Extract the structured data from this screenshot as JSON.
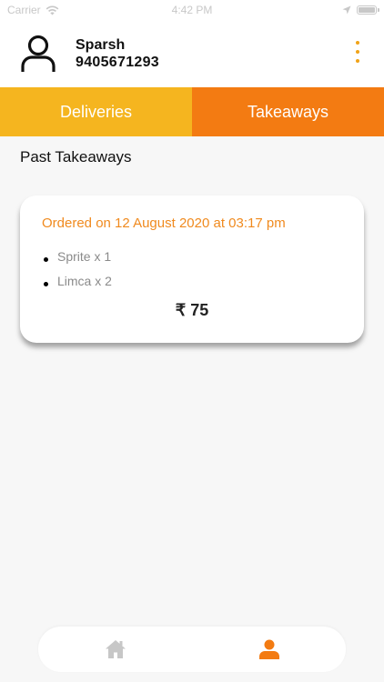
{
  "status_bar": {
    "carrier": "Carrier",
    "time": "4:42 PM"
  },
  "profile": {
    "name": "Sparsh",
    "phone": "9405671293",
    "avatar_icon": "user-outline-icon",
    "menu_icon": "more-vertical-icon"
  },
  "tabs": [
    {
      "label": "Deliveries",
      "color": "#f5b51f"
    },
    {
      "label": "Takeaways",
      "color": "#f37b12"
    }
  ],
  "section_title": "Past Takeaways",
  "orders": [
    {
      "date_text": "Ordered on 12 August 2020  at 03:17 pm",
      "items": [
        "Sprite x 1",
        "Limca x 2"
      ],
      "total": "₹ 75"
    }
  ],
  "bottom_nav": {
    "items": [
      {
        "icon": "home-icon",
        "active": false
      },
      {
        "icon": "user-icon",
        "active": true
      }
    ]
  },
  "colors": {
    "accent": "#f08a1e",
    "accent_dark": "#f37b12",
    "accent_light": "#f5b51f",
    "inactive_icon": "#c7c7c7"
  }
}
